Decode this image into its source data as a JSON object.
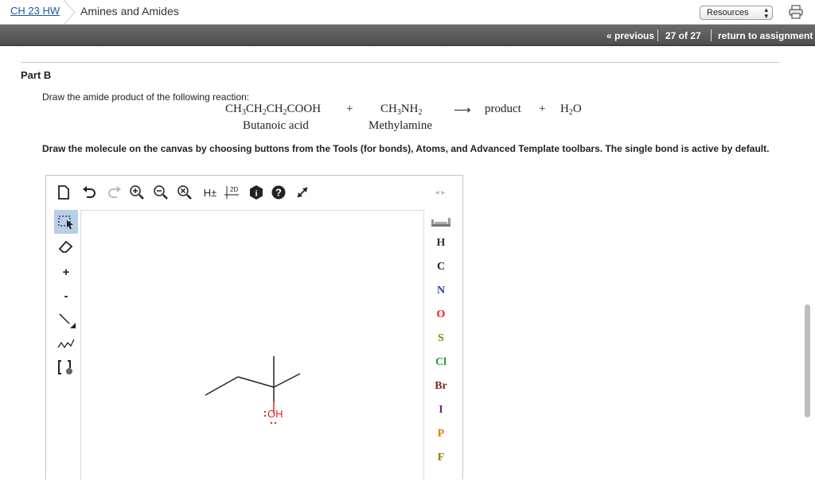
{
  "header": {
    "breadcrumb_course": "CH 23 HW",
    "breadcrumb_assignment": "Amines and Amides",
    "resources_label": "Resources"
  },
  "nav": {
    "previous": "« previous",
    "position": "27 of 27",
    "return": "return to assignment"
  },
  "part": {
    "title": "Part B",
    "prompt": "Draw the amide product of the following reaction:",
    "reaction": {
      "plus": "+",
      "arrow": "⟶",
      "product": "product",
      "reactant2_name": "Butanoic acid",
      "reactant3_name": "Methylamine"
    },
    "instructions": "Draw the molecule on the canvas by choosing buttons from the Tools (for bonds), Atoms, and Advanced Template toolbars. The single bond is active by default."
  },
  "editor": {
    "top_tools": [
      "new-document",
      "undo",
      "redo",
      "zoom-in",
      "zoom-out",
      "clear",
      "explicit-hydrogens",
      "2d-clean",
      "info",
      "help",
      "fullscreen"
    ],
    "hydrogen_label": "H±",
    "clean_label": "2D",
    "left_tools": [
      "select",
      "erase",
      "charge-plus",
      "charge-minus",
      "single-bond",
      "chain",
      "template"
    ],
    "plus_label": "+",
    "minus_label": "-",
    "canvas_atom_label": "OH",
    "atoms": [
      {
        "symbol": "H",
        "color": "#333333"
      },
      {
        "symbol": "C",
        "color": "#222222"
      },
      {
        "symbol": "N",
        "color": "#2a3fb0"
      },
      {
        "symbol": "O",
        "color": "#e0251b"
      },
      {
        "symbol": "S",
        "color": "#8a8a00"
      },
      {
        "symbol": "Cl",
        "color": "#2a9a2a"
      },
      {
        "symbol": "Br",
        "color": "#7a2a1a"
      },
      {
        "symbol": "I",
        "color": "#7a1aa0"
      },
      {
        "symbol": "P",
        "color": "#e07a00"
      },
      {
        "symbol": "F",
        "color": "#8a7a00"
      }
    ]
  }
}
